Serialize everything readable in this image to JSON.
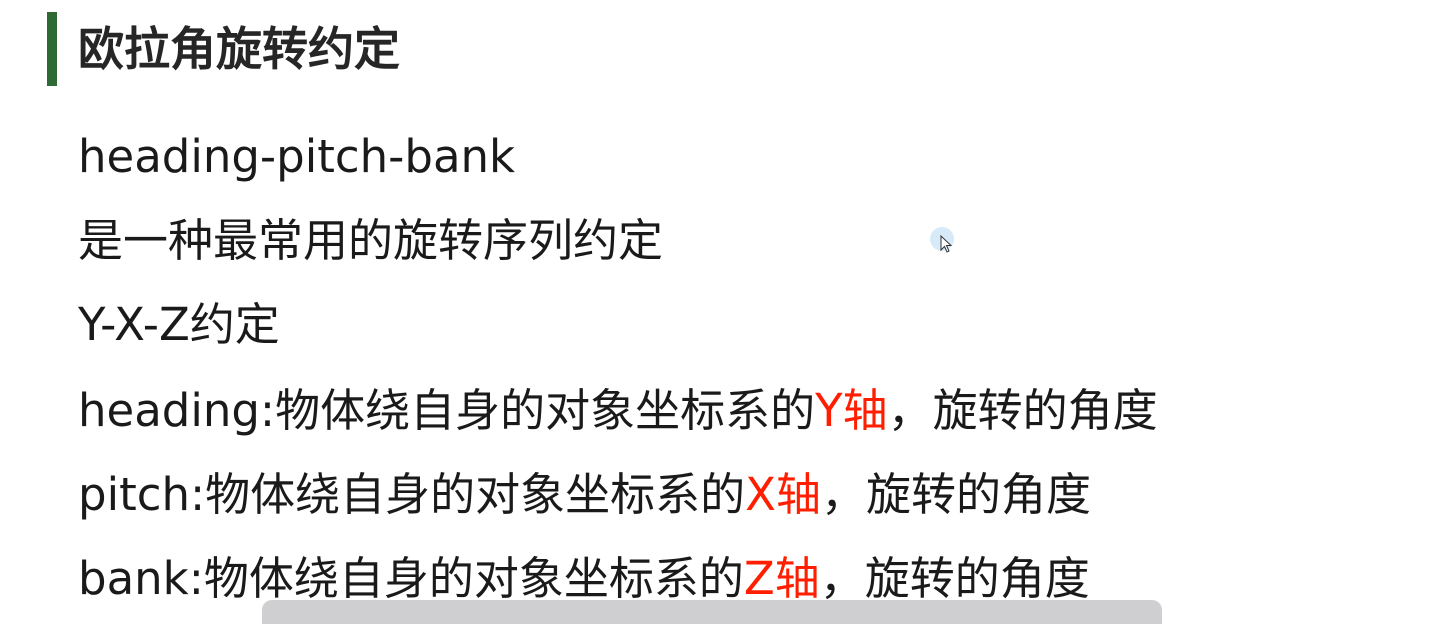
{
  "slide": {
    "title": "欧拉角旋转约定",
    "lines": [
      {
        "text": "heading-pitch-bank"
      },
      {
        "text": "是一种最常用的旋转序列约定"
      },
      {
        "text": "Y-X-Z约定"
      },
      {
        "prefix": "heading:物体绕自身的对象坐标系的",
        "axis": "Y轴",
        "suffix": "，旋转的角度"
      },
      {
        "prefix": "pitch:物体绕自身的对象坐标系的",
        "axis": "X轴",
        "suffix": "，旋转的角度"
      },
      {
        "prefix": "bank:物体绕自身的对象坐标系的",
        "axis": "Z轴",
        "suffix": "，旋转的角度"
      }
    ]
  },
  "colors": {
    "accent_bar": "#2e6b34",
    "axis_highlight": "#ff1f00",
    "text": "#1a1a1a"
  },
  "icons": {
    "cursor": "mouse-pointer-icon"
  }
}
